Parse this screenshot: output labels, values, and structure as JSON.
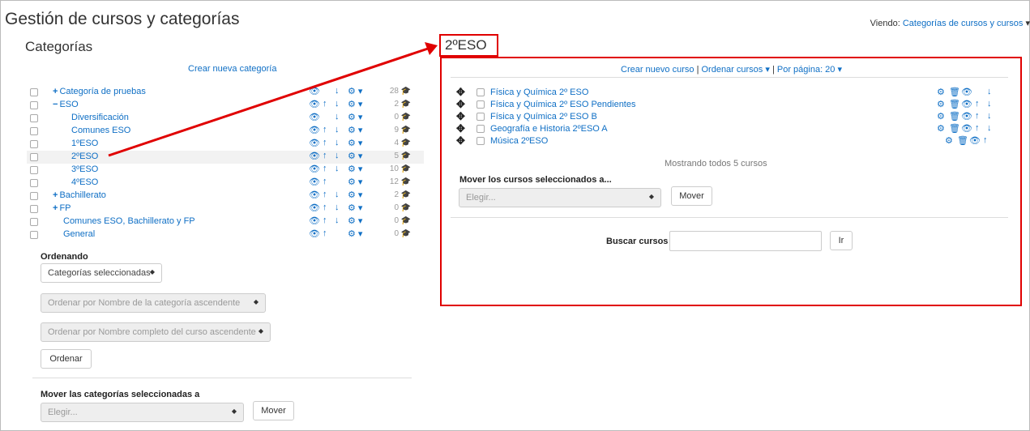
{
  "page_title": "Gestión de cursos y categorías",
  "viewing": {
    "label": "Viendo:",
    "value": "Categorías de cursos y cursos",
    "caret": "▾"
  },
  "categories": {
    "heading": "Categorías",
    "create_link": "Crear nueva categoría",
    "items": [
      {
        "tree": "+",
        "name": "Categoría de pruebas",
        "count": "28",
        "actions": [
          "eye",
          "down",
          "gear"
        ]
      },
      {
        "tree": "−",
        "name": "ESO",
        "count": "2",
        "actions": [
          "eye",
          "up",
          "down",
          "gear"
        ]
      },
      {
        "tree": "",
        "name": "Diversificación",
        "count": "0",
        "actions": [
          "eye",
          "down",
          "gear"
        ]
      },
      {
        "tree": "",
        "name": "Comunes ESO",
        "count": "9",
        "actions": [
          "eye",
          "up",
          "down",
          "gear"
        ]
      },
      {
        "tree": "",
        "name": "1ºESO",
        "count": "4",
        "actions": [
          "eye",
          "up",
          "down",
          "gear"
        ]
      },
      {
        "tree": "",
        "name": "2ºESO",
        "count": "5",
        "actions": [
          "eye",
          "up",
          "down",
          "gear"
        ]
      },
      {
        "tree": "",
        "name": "3ºESO",
        "count": "10",
        "actions": [
          "eye",
          "up",
          "down",
          "gear"
        ]
      },
      {
        "tree": "",
        "name": "4ºESO",
        "count": "12",
        "actions": [
          "eye",
          "up",
          "gear"
        ]
      },
      {
        "tree": "+",
        "name": "Bachillerato",
        "count": "2",
        "actions": [
          "eye",
          "up",
          "down",
          "gear"
        ]
      },
      {
        "tree": "+",
        "name": "FP",
        "count": "0",
        "actions": [
          "eye",
          "up",
          "down",
          "gear"
        ]
      },
      {
        "tree": "",
        "name": "Comunes ESO, Bachillerato y FP",
        "count": "0",
        "actions": [
          "eye",
          "up",
          "down",
          "gear"
        ]
      },
      {
        "tree": "",
        "name": "General",
        "count": "0",
        "actions": [
          "eye",
          "up",
          "gear"
        ]
      }
    ],
    "sorting": {
      "label": "Ordenando",
      "scope_select": "Categorías seleccionadas",
      "cat_sort_select": "Ordenar por Nombre de la categoría ascendente",
      "course_sort_select": "Ordenar por Nombre completo del curso ascendente",
      "sort_button": "Ordenar"
    },
    "move": {
      "label": "Mover las categorías seleccionadas a",
      "select_placeholder": "Elegir...",
      "move_button": "Mover"
    }
  },
  "courses": {
    "heading": "2ºESO",
    "toolbar": {
      "create": "Crear nuevo curso",
      "sep1": "|",
      "sort": "Ordenar cursos ▾",
      "sep2": "|",
      "perpage": "Por página: 20 ▾"
    },
    "items": [
      {
        "name": "Física y Química 2º ESO",
        "actions": [
          "gear",
          "trash",
          "eye",
          "down"
        ]
      },
      {
        "name": "Física y Química 2º ESO Pendientes",
        "actions": [
          "gear",
          "trash",
          "eye",
          "up",
          "down"
        ]
      },
      {
        "name": "Física y Química 2º ESO B",
        "actions": [
          "gear",
          "trash",
          "eye",
          "up",
          "down"
        ]
      },
      {
        "name": "Geografía e Historia 2ºESO A",
        "actions": [
          "gear",
          "trash",
          "eye",
          "up",
          "down"
        ]
      },
      {
        "name": "Música 2ºESO",
        "actions": [
          "gear",
          "trash",
          "eye",
          "up"
        ]
      }
    ],
    "showing": "Mostrando todos 5 cursos",
    "move": {
      "label": "Mover los cursos seleccionados a...",
      "select_placeholder": "Elegir...",
      "move_button": "Mover"
    },
    "search": {
      "label": "Buscar cursos",
      "value": "",
      "button": "Ir"
    }
  },
  "colors": {
    "link": "#0f6fc5",
    "annotation_red": "#e00000"
  }
}
